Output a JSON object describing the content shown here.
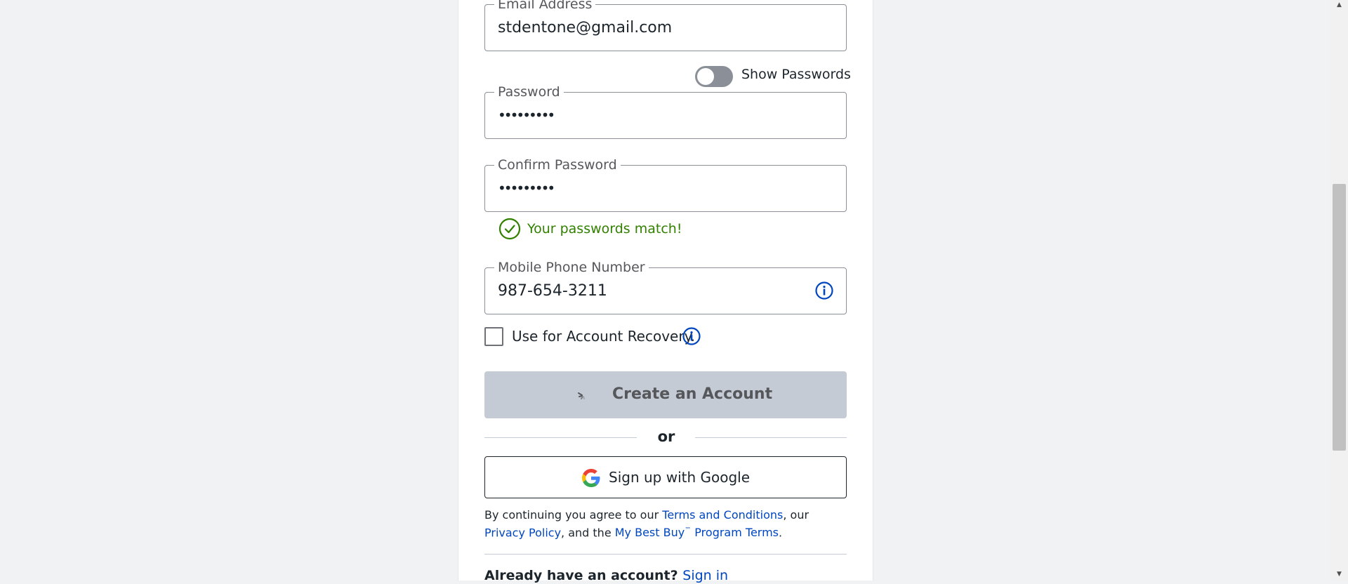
{
  "form": {
    "email": {
      "label": "Email Address",
      "value": "stdentone@gmail.com"
    },
    "show_passwords": {
      "label": "Show Passwords",
      "enabled": false
    },
    "password": {
      "label": "Password",
      "masked_value": "•••••••••"
    },
    "confirm_password": {
      "label": "Confirm Password",
      "masked_value": "•••••••••"
    },
    "match_message": "Your passwords match!",
    "phone": {
      "label": "Mobile Phone Number",
      "value": "987-654-3211",
      "icon": "info-icon"
    },
    "recovery": {
      "label": "Use for Account Recovery.",
      "checked": false,
      "icon": "info-icon"
    },
    "create_button": {
      "label": "Create an Account",
      "state": "loading"
    },
    "or_text": "or",
    "google_button": {
      "label": "Sign up with Google",
      "icon": "google-icon"
    },
    "terms": {
      "prefix": "By continuing you agree to our ",
      "terms_link": "Terms and Conditions",
      "mid1": ", our ",
      "privacy_link": "Privacy Policy",
      "mid2": ", and the ",
      "program_link_pre": "My Best Buy",
      "program_tm": "™",
      "program_link_post": " Program Terms",
      "suffix": "."
    },
    "already": {
      "text": "Already have an account? ",
      "sign_in_link": "Sign in"
    }
  },
  "colors": {
    "page_background": "#f0f2f4",
    "link": "#0046be",
    "success": "#318000",
    "disabled_button": "#c5cbd5"
  }
}
